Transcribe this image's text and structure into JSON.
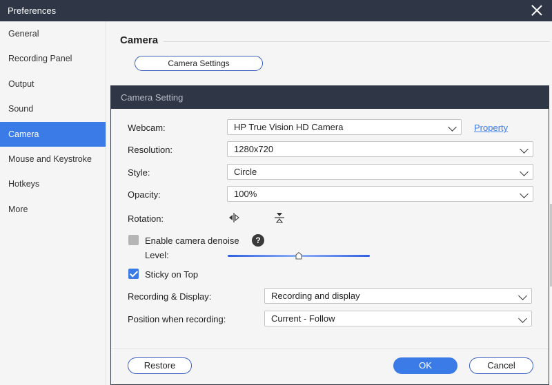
{
  "window": {
    "title": "Preferences"
  },
  "sidebar": {
    "items": [
      {
        "label": "General"
      },
      {
        "label": "Recording Panel"
      },
      {
        "label": "Output"
      },
      {
        "label": "Sound"
      },
      {
        "label": "Camera"
      },
      {
        "label": "Mouse and Keystroke"
      },
      {
        "label": "Hotkeys"
      },
      {
        "label": "More"
      }
    ],
    "active_index": 4
  },
  "main": {
    "section_title": "Camera",
    "camera_settings_button": "Camera Settings"
  },
  "dialog": {
    "title": "Camera Setting",
    "webcam": {
      "label": "Webcam:",
      "value": "HP True Vision HD Camera",
      "property_link": "Property"
    },
    "resolution": {
      "label": "Resolution:",
      "value": "1280x720"
    },
    "style": {
      "label": "Style:",
      "value": "Circle"
    },
    "opacity": {
      "label": "Opacity:",
      "value": "100%"
    },
    "rotation": {
      "label": "Rotation:",
      "icons": [
        "flip-horizontal-icon",
        "flip-vertical-icon"
      ]
    },
    "denoise": {
      "label": "Enable camera denoise",
      "checked": false,
      "help": "?"
    },
    "level": {
      "label": "Level:",
      "value_fraction": 0.5
    },
    "sticky": {
      "label": "Sticky on Top",
      "checked": true
    },
    "recording_display": {
      "label": "Recording & Display:",
      "value": "Recording and display"
    },
    "position": {
      "label": "Position when recording:",
      "value": "Current - Follow"
    },
    "buttons": {
      "restore": "Restore",
      "ok": "OK",
      "cancel": "Cancel"
    }
  },
  "colors": {
    "accent": "#3b7be8",
    "titlebar": "#2f3747",
    "background": "#f5f5f5"
  }
}
